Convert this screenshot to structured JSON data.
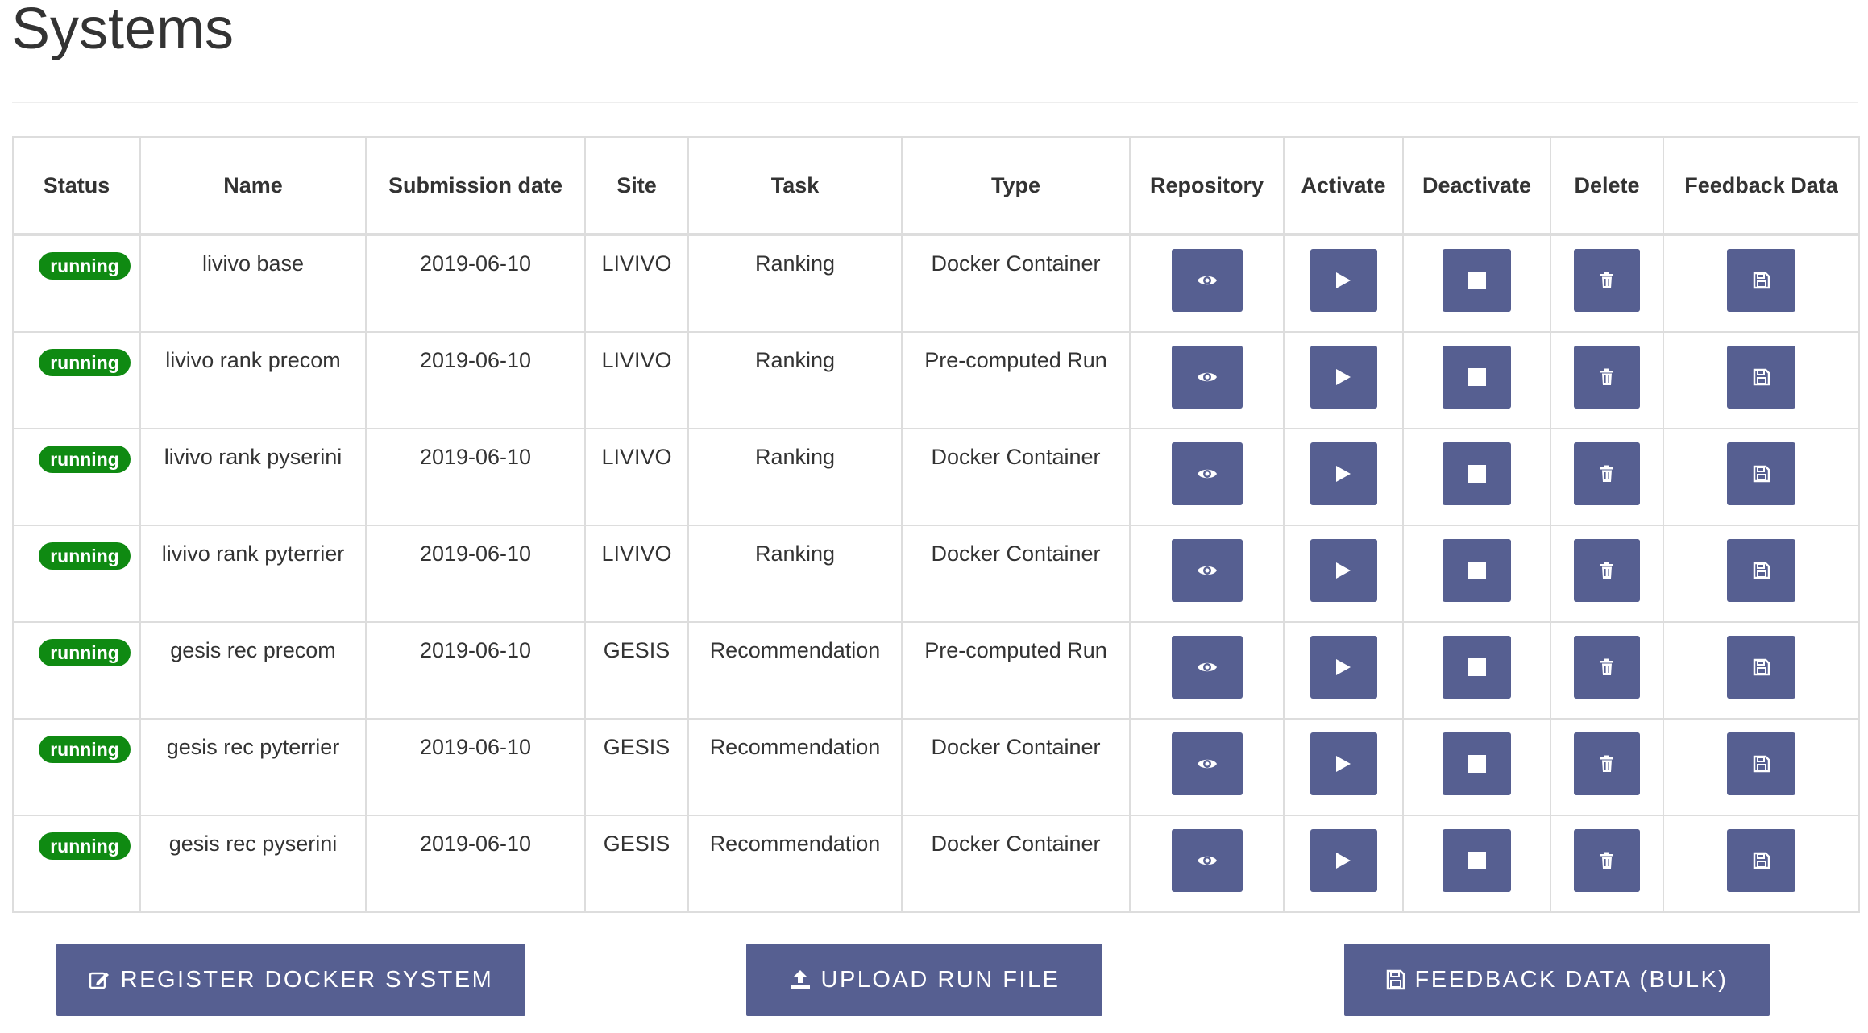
{
  "page": {
    "title": "Systems"
  },
  "table": {
    "headers": [
      "Status",
      "Name",
      "Submission date",
      "Site",
      "Task",
      "Type",
      "Repository",
      "Activate",
      "Deactivate",
      "Delete",
      "Feedback Data"
    ],
    "rows": [
      {
        "status": "running",
        "name": "livivo base",
        "date": "2019-06-10",
        "site": "LIVIVO",
        "task": "Ranking",
        "type": "Docker Container"
      },
      {
        "status": "running",
        "name": "livivo rank precom",
        "date": "2019-06-10",
        "site": "LIVIVO",
        "task": "Ranking",
        "type": "Pre-computed Run"
      },
      {
        "status": "running",
        "name": "livivo rank pyserini",
        "date": "2019-06-10",
        "site": "LIVIVO",
        "task": "Ranking",
        "type": "Docker Container"
      },
      {
        "status": "running",
        "name": "livivo rank pyterrier",
        "date": "2019-06-10",
        "site": "LIVIVO",
        "task": "Ranking",
        "type": "Docker Container"
      },
      {
        "status": "running",
        "name": "gesis rec precom",
        "date": "2019-06-10",
        "site": "GESIS",
        "task": "Recommendation",
        "type": "Pre-computed Run"
      },
      {
        "status": "running",
        "name": "gesis rec pyterrier",
        "date": "2019-06-10",
        "site": "GESIS",
        "task": "Recommendation",
        "type": "Docker Container"
      },
      {
        "status": "running",
        "name": "gesis rec pyserini",
        "date": "2019-06-10",
        "site": "GESIS",
        "task": "Recommendation",
        "type": "Docker Container"
      }
    ]
  },
  "actions": {
    "register_label": "REGISTER DOCKER SYSTEM",
    "upload_label": "UPLOAD RUN FILE",
    "feedback_bulk_label": "FEEDBACK DATA (BULK)"
  },
  "icons": {
    "repository": "eye-icon",
    "activate": "play-icon",
    "deactivate": "stop-icon",
    "delete": "trash-icon",
    "feedback": "floppy-disk-icon",
    "register": "edit-icon",
    "upload": "upload-icon"
  },
  "colors": {
    "button": "#565f91",
    "badge_running": "#0f8a12",
    "border": "#dddddd",
    "text": "#333333"
  }
}
